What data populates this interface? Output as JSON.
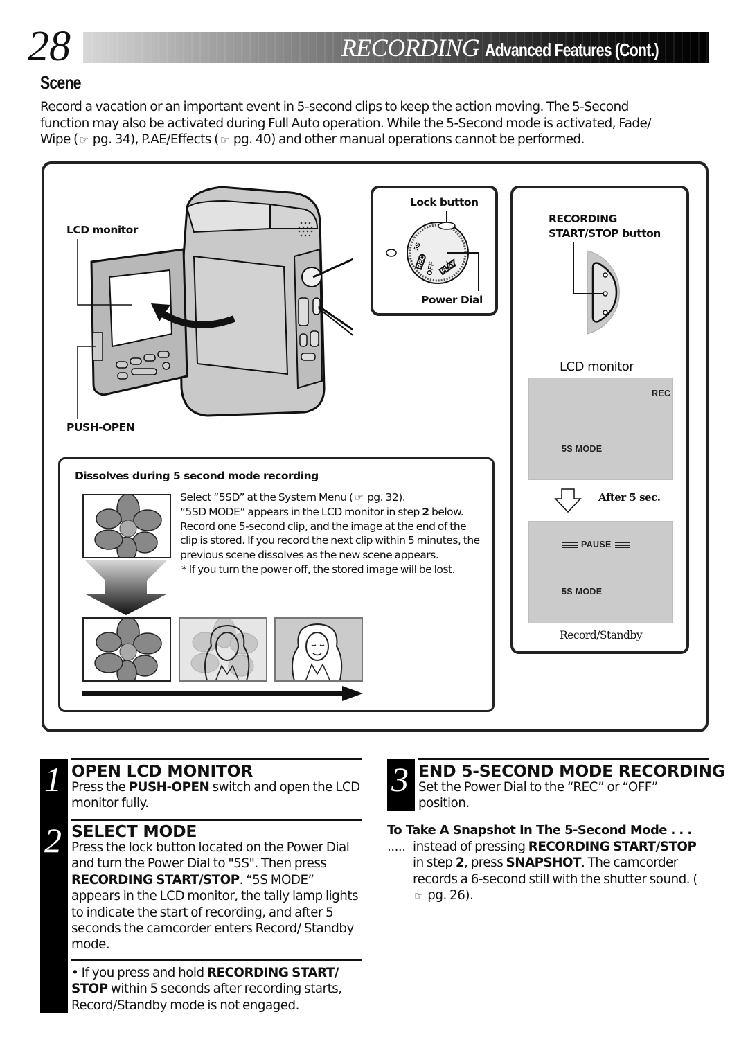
{
  "header": {
    "page_number": "28",
    "section": "RECORDING",
    "subtitle": "Advanced Features (Cont.)"
  },
  "scene": {
    "title": "Scene",
    "intro": [
      {
        "t": "Record a vacation or an important event in 5-second clips to keep the action moving. The 5-Second function may also be activated during Full Auto operation. While the 5-Second mode is activated, Fade/ Wipe ("
      },
      {
        "icon": "reference-hand-icon",
        "glyph": "☞"
      },
      {
        "t": " pg. 34), P.AE/Effects ("
      },
      {
        "icon": "reference-hand-icon",
        "glyph": "☞"
      },
      {
        "t": " pg. 40) and other manual operations cannot be performed."
      }
    ]
  },
  "illustration": {
    "camera_labels": {
      "lcd_monitor": "LCD monitor",
      "push_open": "PUSH-OPEN"
    },
    "dial": {
      "lock_button": "Lock button",
      "power_dial": "Power Dial",
      "positions": [
        "5S",
        "REC",
        "OFF",
        "PLAY"
      ]
    },
    "rec_button": {
      "label_line1": "RECORDING",
      "label_line2": "START/STOP button"
    },
    "lcd": {
      "title": "LCD monitor",
      "screen1": {
        "top_right": "REC",
        "bottom": "5S  MODE"
      },
      "transition": "After 5 sec.",
      "screen2": {
        "center": "PAUSE",
        "bottom": "5S  MODE"
      },
      "caption": "Record/Standby"
    },
    "dissolve": {
      "title": "Dissolves during 5 second mode recording",
      "line1_pre": "Select “5SD” at the System Menu (",
      "ref_glyph": "☞",
      "line1_post": " pg. 32).",
      "line2_pre": "“5SD MODE” appears in the LCD monitor in step ",
      "line2_bold": "2",
      "line2_post": " below. Record one 5-second clip, and the image at the end of the clip is stored. If you record the next clip within 5 minutes, the previous scene dissolves as the new scene appears.",
      "note": "* If you turn the power off, the stored image will be lost."
    }
  },
  "steps": [
    {
      "number": "1",
      "title": "OPEN LCD MONITOR",
      "body_pre": "Press the ",
      "body_bold": "PUSH-OPEN",
      "body_post": " switch and open the LCD monitor fully."
    },
    {
      "number": "2",
      "title": "SELECT MODE",
      "body_pre": "Press the lock button located on the Power Dial and turn the Power Dial to \"5S\". Then press ",
      "body_bold": "RECORDING START/STOP",
      "body_post": ". “5S MODE” appears in the LCD monitor, the tally lamp lights to indicate the start of recording, and after 5 seconds the camcorder enters Record/ Standby mode.",
      "note_pre": "• If you press and hold ",
      "note_bold": "RECORDING START/ STOP",
      "note_post": " within 5 seconds after recording starts, Record/Standby mode is not engaged."
    },
    {
      "number": "3",
      "title": "END 5-SECOND MODE RECORDING",
      "body": "Set the Power Dial to the “REC” or “OFF” position."
    }
  ],
  "snapshot": {
    "title": "To Take A Snapshot In The 5-Second Mode . . .",
    "lead": ".....",
    "t1": " instead of pressing ",
    "b1": "RECORDING START/STOP",
    "t2": " in step ",
    "b2": "2",
    "t3": ", press ",
    "b3": "SNAPSHOT",
    "t4": ". The camcorder records a 6-second still with the shutter sound. (",
    "ref_glyph": "☞",
    "t5": " pg. 26)."
  }
}
